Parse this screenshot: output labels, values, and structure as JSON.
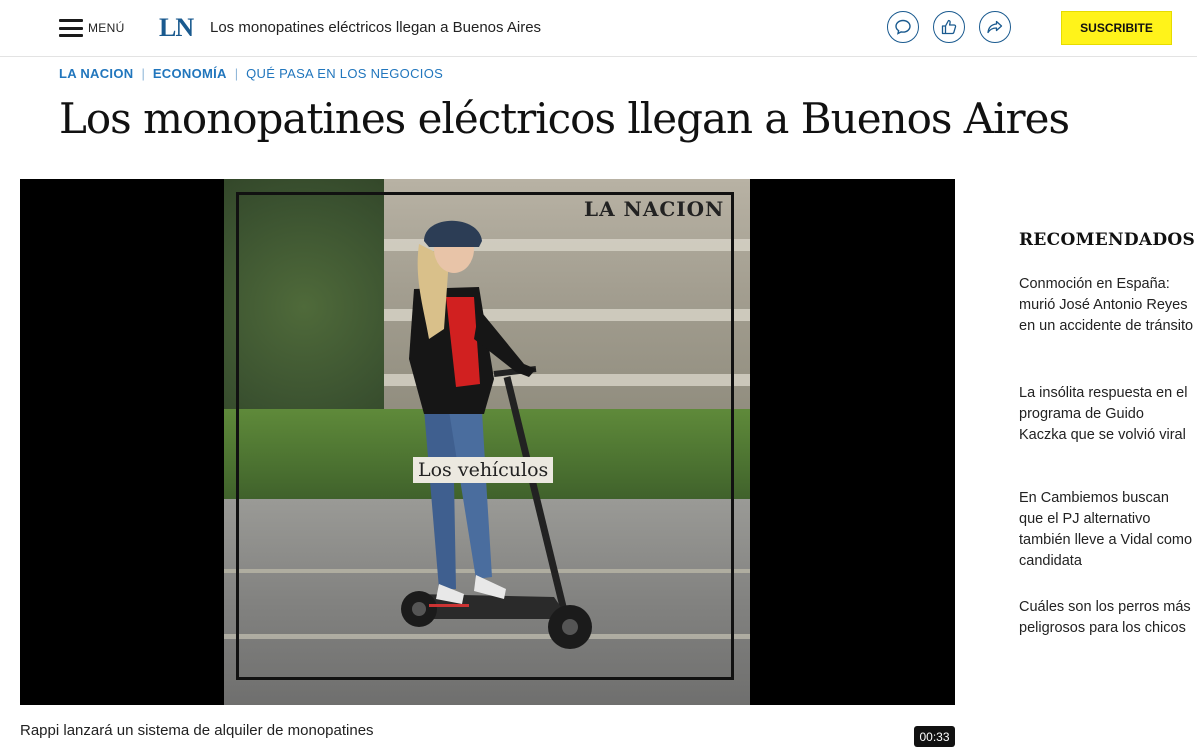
{
  "topbar": {
    "menu_label": "MENÚ",
    "logo": "LN",
    "title": "Los monopatines eléctricos llegan a Buenos Aires",
    "icons": [
      "comment-icon",
      "like-icon",
      "share-icon"
    ],
    "subscribe_label": "SUSCRIBITE"
  },
  "breadcrumb": [
    "LA NACION",
    "ECONOMÍA",
    "QUÉ PASA EN LOS NEGOCIOS"
  ],
  "headline": "Los monopatines eléctricos llegan a Buenos Aires",
  "video": {
    "watermark": "LA NACION",
    "overlay_caption": "Los vehículos",
    "caption": "Rappi lanzará un sistema de alquiler de monopatines",
    "duration": "00:33"
  },
  "recommended": {
    "title": "RECOMENDADOS",
    "items": [
      "Conmoción en España: murió José Antonio Reyes en un accidente de tránsito",
      "La insólita respuesta en el programa de Guido Kaczka que se volvió viral",
      "En Cambiemos buscan que el PJ alternativo también lleve a Vidal como candidata",
      "Cuáles son los perros más peligrosos para los chicos"
    ]
  },
  "colors": {
    "accent": "#2176bd",
    "logo": "#1a5a8f",
    "subscribe": "#fff31a"
  }
}
